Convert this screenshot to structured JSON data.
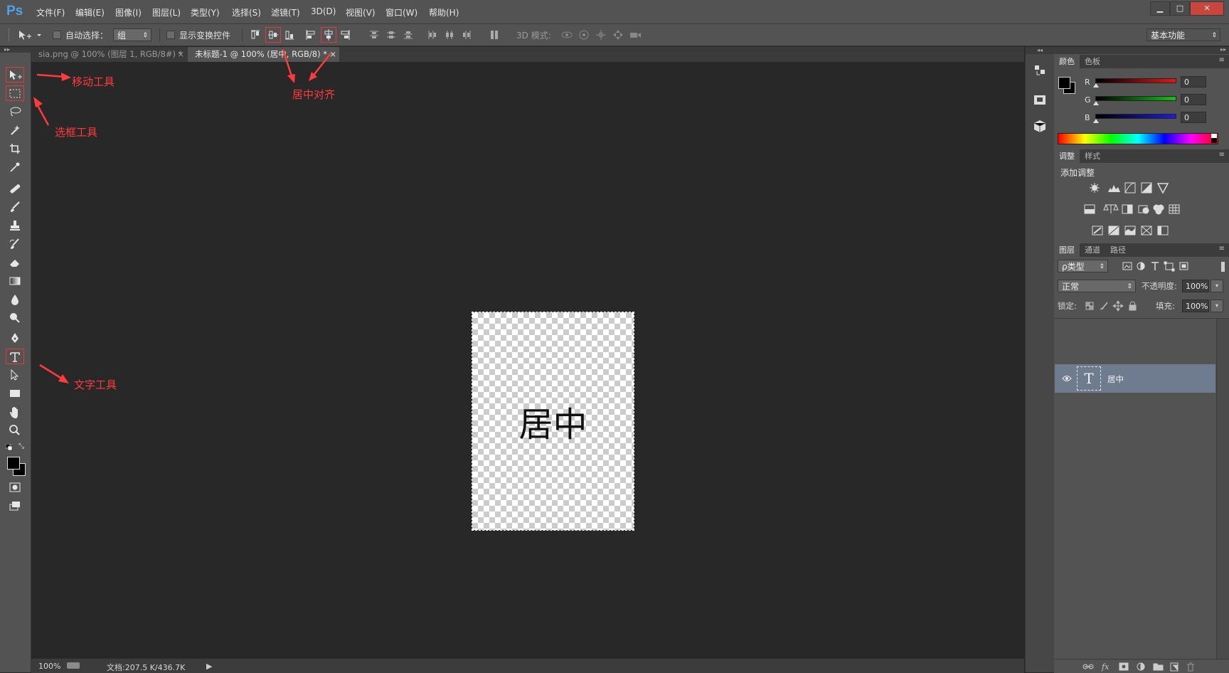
{
  "app": {
    "logo": "Ps"
  },
  "menu": [
    "文件(F)",
    "编辑(E)",
    "图像(I)",
    "图层(L)",
    "类型(Y)",
    "选择(S)",
    "滤镜(T)",
    "3D(D)",
    "视图(V)",
    "窗口(W)",
    "帮助(H)"
  ],
  "window_controls": {
    "minimize": "▁",
    "maximize": "□",
    "close": "✕"
  },
  "options": {
    "auto_select_label": "自动选择：",
    "auto_select_value": "组",
    "show_transform_label": "显示变换控件",
    "mode_3d_label": "3D 模式:",
    "workspace": "基本功能"
  },
  "tabs": [
    {
      "title": "sia.png @ 100% (图层 1, RGB/8#) *",
      "close": "×"
    },
    {
      "title": "未标题-1 @ 100% (居中, RGB/8) *",
      "close": "×"
    }
  ],
  "canvas": {
    "text": "居中"
  },
  "annotations": {
    "move_tool": "移动工具",
    "marquee_tool": "选框工具",
    "text_tool": "文字工具",
    "center_align": "居中对齐"
  },
  "status": {
    "zoom": "100%",
    "doc_info": "文档:207.5 K/436.7K",
    "arrow": "▶"
  },
  "color_panel": {
    "tabs": [
      "颜色",
      "色板"
    ],
    "channels": [
      {
        "label": "R",
        "value": "0",
        "color": "#e01818"
      },
      {
        "label": "G",
        "value": "0",
        "color": "#18c018"
      },
      {
        "label": "B",
        "value": "0",
        "color": "#1c1ce0"
      }
    ]
  },
  "adjust_panel": {
    "tabs": [
      "调整",
      "样式"
    ],
    "title": "添加调整"
  },
  "layers_panel": {
    "tabs": [
      "图层",
      "通道",
      "路径"
    ],
    "filter": "ρ类型",
    "blend": "正常",
    "opacity_label": "不透明度:",
    "opacity": "100%",
    "lock_label": "锁定:",
    "fill_label": "填充:",
    "fill": "100%",
    "layers": [
      {
        "name": "居中",
        "thumb": "T"
      }
    ]
  },
  "colors": {
    "accent": "#4aa6ea",
    "annotation": "#ff3b3b",
    "layer_selected": "#6f7c8f"
  }
}
